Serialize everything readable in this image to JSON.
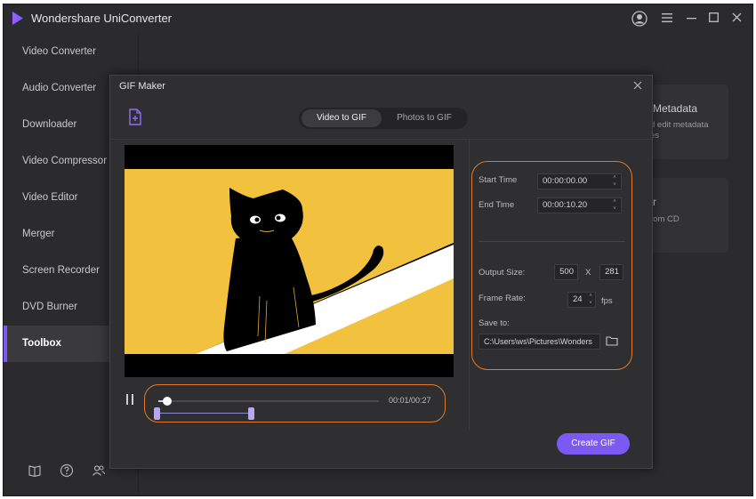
{
  "app": {
    "title": "Wondershare UniConverter"
  },
  "colors": {
    "accent": "#7b5af4",
    "highlight": "#e07a2a",
    "video_bg": "#f2c23e"
  },
  "sidebar": {
    "items": [
      {
        "label": "Video Converter"
      },
      {
        "label": "Audio Converter"
      },
      {
        "label": "Downloader"
      },
      {
        "label": "Video Compressor"
      },
      {
        "label": "Video Editor"
      },
      {
        "label": "Merger"
      },
      {
        "label": "Screen Recorder"
      },
      {
        "label": "DVD Burner"
      },
      {
        "label": "Toolbox",
        "active": true
      }
    ],
    "bottom_icons": [
      "book-icon",
      "help-icon",
      "account-icon"
    ]
  },
  "background": {
    "card1_title": "Metadata",
    "card1_desc_line1": "d edit metadata",
    "card1_desc_line2": "es",
    "card2_title": "r",
    "card2_desc": "rom CD"
  },
  "dialog": {
    "title": "GIF Maker",
    "tabs": [
      {
        "label": "Video to GIF",
        "active": true
      },
      {
        "label": "Photos to GIF",
        "active": false
      }
    ],
    "player": {
      "time_readout": "00:01/00:27",
      "progress_fraction": 0.04,
      "range_start_fraction": 0.0,
      "range_end_fraction": 0.43
    },
    "settings": {
      "start_time_label": "Start Time",
      "start_time_value": "00:00:00.00",
      "end_time_label": "End Time",
      "end_time_value": "00:00:10.20",
      "output_size_label": "Output Size:",
      "width": "500",
      "x_separator": "X",
      "height": "281",
      "frame_rate_label": "Frame Rate:",
      "frame_rate_value": "24",
      "fps_unit": "fps",
      "save_to_label": "Save to:",
      "save_path": "C:\\Users\\ws\\Pictures\\Wonders"
    },
    "create_button": "Create GIF"
  }
}
